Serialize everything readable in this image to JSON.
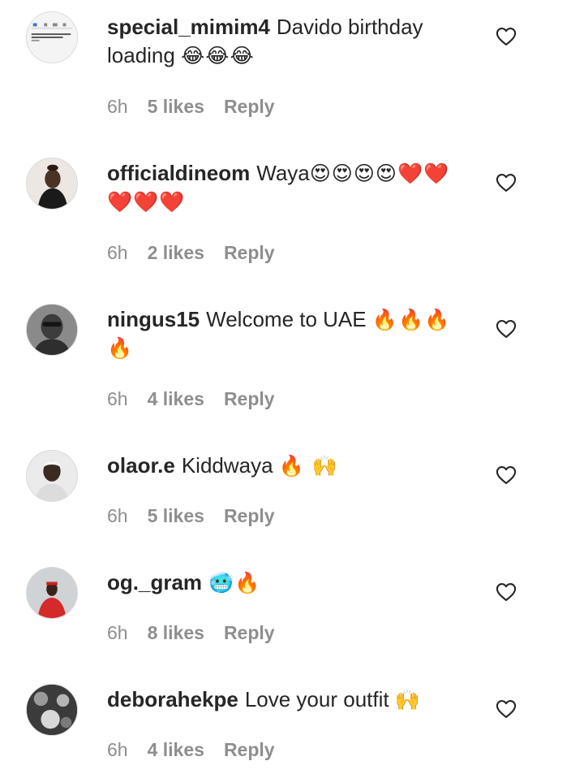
{
  "colors": {
    "text": "#262626",
    "meta": "#8e8e8e",
    "background": "#ffffff"
  },
  "comments": [
    {
      "username": "special_mimim4",
      "text": "Davido birthday loading",
      "emoji": "😂😂😂",
      "time": "6h",
      "likes": "5 likes",
      "reply": "Reply",
      "avatar_icon": "screenshot-thumbnail-avatar"
    },
    {
      "username": "officialdineom",
      "text": "Waya",
      "emoji": "😍😍😍😍❤️❤️❤️❤️❤️",
      "time": "6h",
      "likes": "2 likes",
      "reply": "Reply",
      "avatar_icon": "user-photo-avatar"
    },
    {
      "username": "ningus15",
      "text": "Welcome to UAE",
      "emoji": "🔥🔥🔥🔥",
      "time": "6h",
      "likes": "4 likes",
      "reply": "Reply",
      "avatar_icon": "user-photo-avatar"
    },
    {
      "username": "olaor.e",
      "text": "Kiddwaya",
      "emoji": "🔥 🙌",
      "time": "6h",
      "likes": "5 likes",
      "reply": "Reply",
      "avatar_icon": "user-photo-avatar"
    },
    {
      "username": "og._gram",
      "text": "",
      "emoji": "🥶🔥",
      "time": "6h",
      "likes": "8 likes",
      "reply": "Reply",
      "avatar_icon": "user-photo-avatar"
    },
    {
      "username": "deborahekpe",
      "text": "Love your outfit",
      "emoji": "🙌",
      "time": "6h",
      "likes": "4 likes",
      "reply": "Reply",
      "avatar_icon": "user-photo-avatar"
    }
  ]
}
